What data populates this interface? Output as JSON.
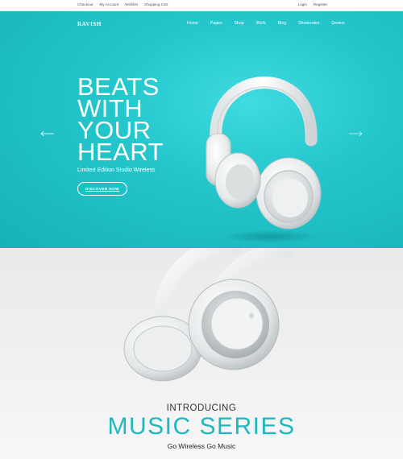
{
  "topbar": {
    "left_links": [
      "Checkout",
      "My Account",
      "Wishlist",
      "Shopping Cart"
    ],
    "right_links": [
      "Login",
      "Register"
    ]
  },
  "nav": {
    "logo": "RAVISH",
    "items": [
      "Home",
      "Pages",
      "Shop",
      "Work",
      "Blog",
      "Shortcodes",
      "Demos"
    ]
  },
  "hero": {
    "headline_lines": [
      "BEATS",
      "WITH",
      "YOUR",
      "HEART"
    ],
    "subline": "Limited Edition Studio Wireless",
    "cta_label": "DISCOVER NOW",
    "prev_icon": "arrow-left-icon",
    "next_icon": "arrow-right-icon",
    "background_color": "#24c7cc"
  },
  "music": {
    "introducing": "INTRODUCING",
    "title": "MUSIC SERIES",
    "tagline": "Go Wireless Go Music",
    "accent_color": "#1fb8be"
  }
}
